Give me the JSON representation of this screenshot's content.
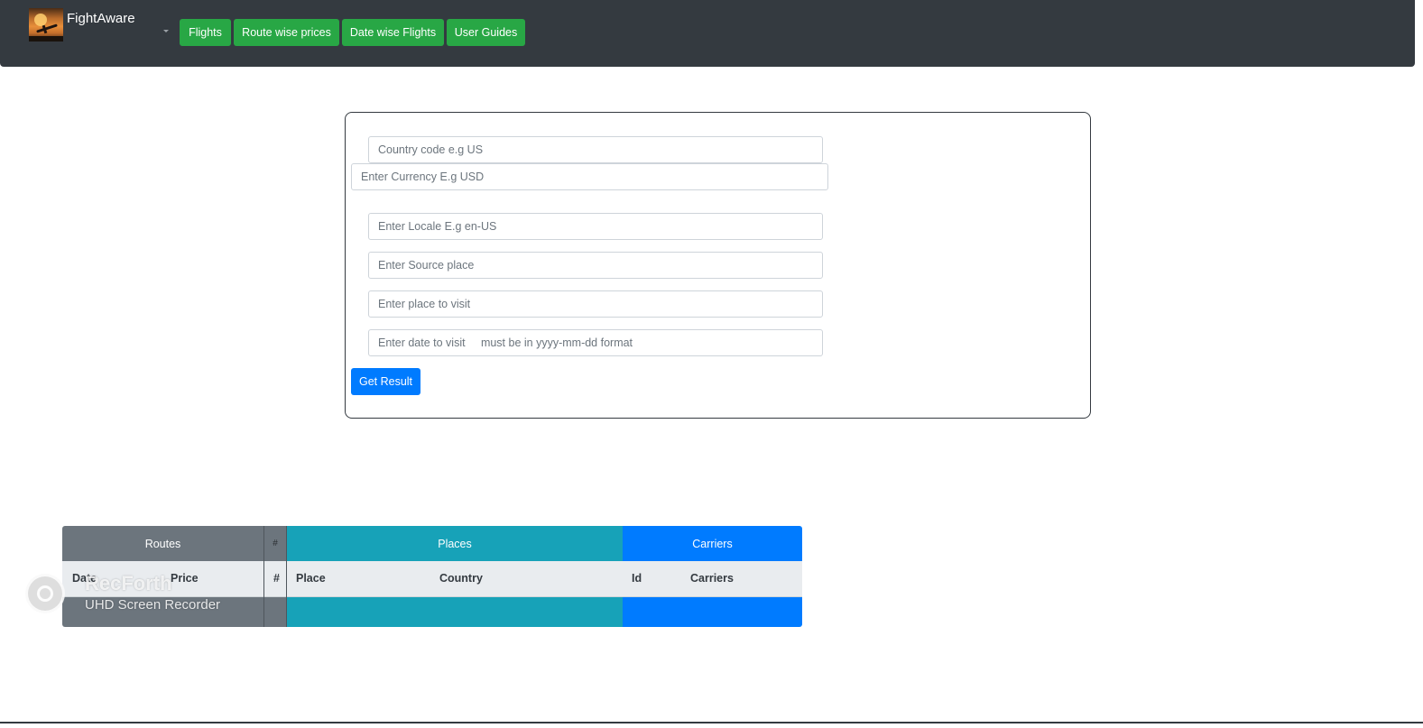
{
  "navbar": {
    "brand": "FightAware",
    "buttons": [
      "Flights",
      "Route wise prices",
      "Date wise Flights",
      "User Guides"
    ]
  },
  "form": {
    "country_placeholder": "Country code e.g US",
    "currency_placeholder": "Enter Currency E.g USD",
    "locale_placeholder": "Enter Locale E.g en-US",
    "source_placeholder": "Enter Source place",
    "destination_placeholder": "Enter place to visit",
    "date_placeholder": "Enter date to visit     must be in yyyy-mm-dd format",
    "submit_label": "Get Result"
  },
  "tables": {
    "routes": {
      "title": "Routes",
      "columns": [
        "Date",
        "Price"
      ]
    },
    "hash": {
      "title": "#",
      "columns": [
        "#"
      ]
    },
    "places": {
      "title": "Places",
      "columns": [
        "Place",
        "Country"
      ]
    },
    "carriers": {
      "title": "Carriers",
      "columns": [
        "Id",
        "Carriers"
      ]
    }
  },
  "watermark": {
    "title": "RecForth",
    "subtitle": "UHD Screen Recorder"
  },
  "colors": {
    "navbar": "#343a40",
    "nav_button": "#28a745",
    "primary": "#007bff",
    "info": "#17a2b8",
    "secondary": "#6c757d"
  }
}
